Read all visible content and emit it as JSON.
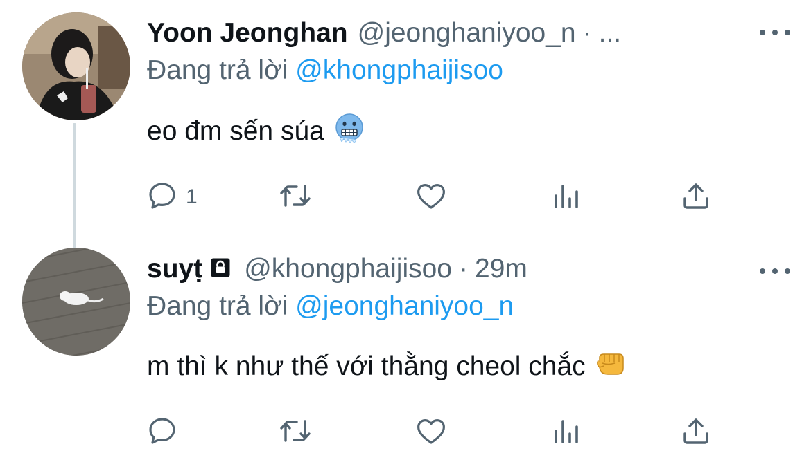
{
  "tweets": [
    {
      "display_name": "Yoon Jeonghan",
      "handle": "@jeonghaniyoo_n",
      "separator": "·",
      "time": "...",
      "reply_prefix": "Đang trả lời ",
      "reply_to": "@khongphaijisoo",
      "text": "eo đm sến súa",
      "emoji": "cold-face-emoji",
      "reply_count": "1",
      "verified_lock": false
    },
    {
      "display_name": "suyṭ",
      "handle": "@khongphaijisoo",
      "separator": "·",
      "time": "29m",
      "reply_prefix": "Đang trả lời ",
      "reply_to": "@jeonghaniyoo_n",
      "text": "m thì k như thế với thằng cheol chắc",
      "emoji": "oncoming-fist-emoji",
      "reply_count": "",
      "verified_lock": true
    }
  ],
  "icons": {
    "reply": "reply-icon",
    "retweet": "retweet-icon",
    "like": "heart-icon",
    "stats": "analytics-icon",
    "share": "share-icon",
    "more": "more-icon",
    "lock": "lock-icon"
  },
  "colors": {
    "text": "#0f1419",
    "muted": "#536471",
    "link": "#1d9bf0",
    "thread_line": "#cfd9de"
  }
}
